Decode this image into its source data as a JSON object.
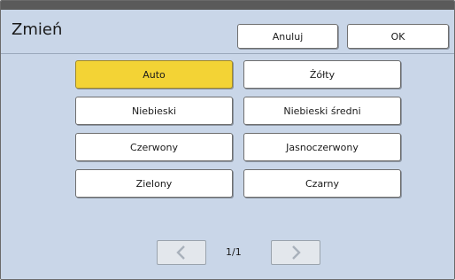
{
  "header": {
    "title": "Zmień",
    "cancel_label": "Anuluj",
    "ok_label": "OK"
  },
  "colors": {
    "selected": "Auto",
    "items": [
      {
        "label": "Auto"
      },
      {
        "label": "Żółty"
      },
      {
        "label": "Niebieski"
      },
      {
        "label": "Niebieski średni"
      },
      {
        "label": "Czerwony"
      },
      {
        "label": "Jasnoczerwony"
      },
      {
        "label": "Zielony"
      },
      {
        "label": "Czarny"
      }
    ]
  },
  "pagination": {
    "indicator": "1/1",
    "prev_icon": "chevron-left-icon",
    "next_icon": "chevron-right-icon"
  },
  "theme": {
    "panel_background": "#c9d6e8",
    "selected_color": "#f3d335"
  }
}
